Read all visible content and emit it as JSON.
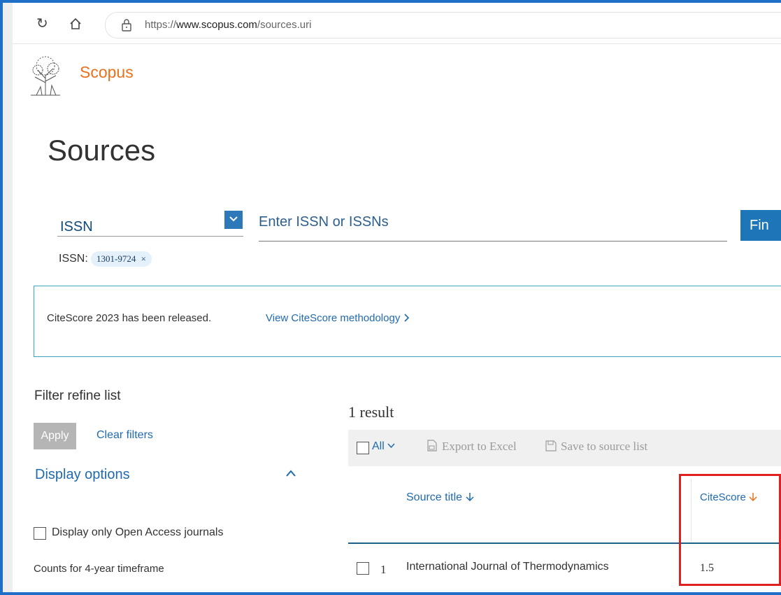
{
  "browser": {
    "url_prefix": "https://",
    "url_host": "www.scopus.com",
    "url_path": "/sources.uri"
  },
  "brand": "Scopus",
  "page_title": "Sources",
  "search": {
    "field_label": "ISSN",
    "placeholder": "Enter ISSN or ISSNs",
    "find_label": "Fin",
    "chip_label": "ISSN:",
    "chip_value": "1301-9724",
    "chip_remove": "×"
  },
  "banner": {
    "text": "CiteScore 2023 has been released.",
    "link": "View CiteScore methodology"
  },
  "filters": {
    "title": "Filter refine list",
    "apply": "Apply",
    "clear": "Clear filters",
    "display_options": "Display options",
    "open_access": "Display only Open Access journals",
    "counts": "Counts for 4-year timeframe"
  },
  "results": {
    "count": "1 result",
    "all": "All",
    "export": "Export to Excel",
    "save": "Save to source list",
    "col_source": "Source title",
    "col_citescore": "CiteScore",
    "rows": [
      {
        "num": "1",
        "title": "International Journal of Thermodynamics",
        "citescore": "1.5"
      }
    ]
  },
  "colors": {
    "brand": "#e9711c",
    "link": "#1f6ab0",
    "highlight": "#e02020"
  }
}
